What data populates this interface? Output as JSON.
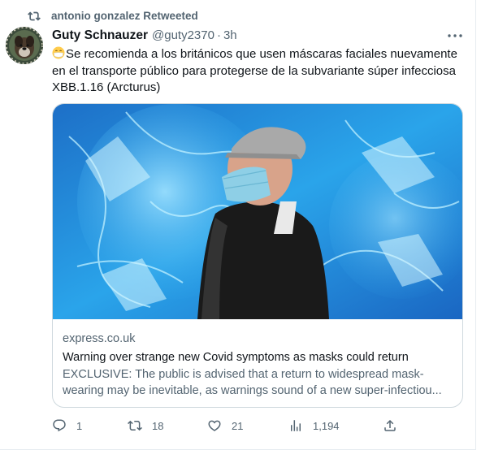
{
  "retweet": {
    "label": "antonio gonzalez Retweeted"
  },
  "tweet": {
    "display_name": "Guty Schnauzer",
    "handle": "@guty2370",
    "separator": "·",
    "time": "3h",
    "emoji_icon": "face-with-medical-mask-emoji",
    "text": "Se recomienda a los británicos que usen máscaras faciales nuevamente en el transporte público para protegerse de la subvariante súper infecciosa XBB.1.16 (Arcturus)"
  },
  "card": {
    "domain": "express.co.uk",
    "title": "Warning over strange new Covid symptoms as masks could return",
    "description": "EXCLUSIVE: The public is advised that a return to widespread mask-wearing may be inevitable, as warnings sound of a new super-infectiou..."
  },
  "actions": {
    "replies": "1",
    "retweets": "18",
    "likes": "21",
    "views": "1,194"
  },
  "colors": {
    "text_primary": "#0f1419",
    "text_secondary": "#536471",
    "border": "#cfd9de",
    "image_blue": "#1f8fdc"
  }
}
